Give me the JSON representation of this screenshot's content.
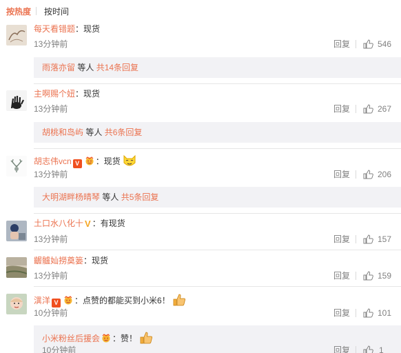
{
  "sort": {
    "hot_label": "按热度",
    "time_label": "按时间"
  },
  "comments": [
    {
      "user": "每天看错题",
      "text": "：现货",
      "time": "13分钟前",
      "reply": "回复",
      "likes": "546",
      "sub": {
        "user": "雨落亦留",
        "mid": " 等人 ",
        "count": "共14条回复"
      }
    },
    {
      "user": "主啊赐个妞",
      "text": "：现货",
      "time": "13分钟前",
      "reply": "回复",
      "likes": "267",
      "sub": {
        "user": "胡桃和岛屿",
        "mid": " 等人 ",
        "count": "共6条回复"
      }
    },
    {
      "user": "胡志伟vcn",
      "text": "：现货",
      "time": "13分钟前",
      "reply": "回复",
      "likes": "206",
      "sub": {
        "user": "大明湖畔杨晴琴",
        "mid": " 等人 ",
        "count": "共5条回复"
      }
    },
    {
      "user": "土口水八化十",
      "text": "：有现货",
      "time": "13分钟前",
      "reply": "回复",
      "likes": "157"
    },
    {
      "user": "齷髗奾撈奠篓",
      "text": "：现货",
      "time": "13分钟前",
      "reply": "回复",
      "likes": "159"
    },
    {
      "user": "潩洋",
      "text": "：点赞的都能买到小米6！",
      "time": "10分钟前",
      "reply": "回复",
      "likes": "101",
      "sub": {
        "user": "小米粉丝后援会",
        "mid": "：赞！",
        "time": "10分钟前",
        "reply": "回复",
        "likes": "1"
      }
    }
  ],
  "colors": {
    "accent": "#eb7350",
    "muted": "#808080",
    "sub_bg": "#f2f2f5"
  }
}
